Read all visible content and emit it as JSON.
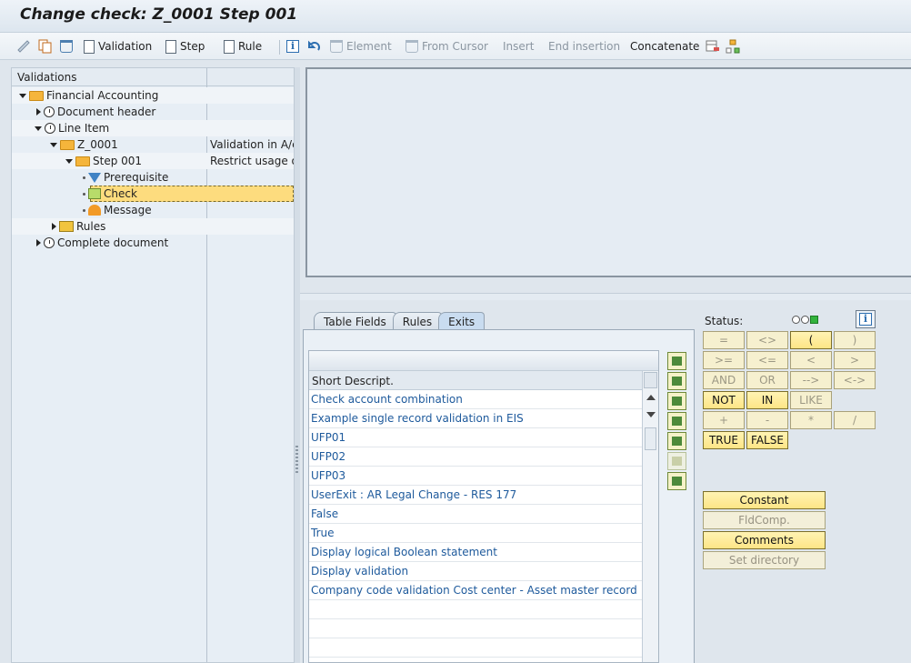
{
  "window": {
    "title": "Change check: Z_0001 Step 001"
  },
  "toolbar": {
    "validation": "Validation",
    "step": "Step",
    "rule": "Rule",
    "element": "Element",
    "from_cursor": "From Cursor",
    "insert": "Insert",
    "end_insertion": "End insertion",
    "concatenate": "Concatenate"
  },
  "tree": {
    "header": "Validations",
    "nodes": [
      {
        "label": "Financial Accounting",
        "desc": ""
      },
      {
        "label": "Document header",
        "desc": ""
      },
      {
        "label": "Line Item",
        "desc": ""
      },
      {
        "label": "Z_0001",
        "desc": "Validation in A/c"
      },
      {
        "label": "Step 001",
        "desc": "Restrict usage of"
      },
      {
        "label": "Prerequisite",
        "desc": ""
      },
      {
        "label": "Check",
        "desc": ""
      },
      {
        "label": "Message",
        "desc": ""
      },
      {
        "label": "Rules",
        "desc": ""
      },
      {
        "label": "Complete document",
        "desc": ""
      }
    ]
  },
  "tabs": [
    "Table Fields",
    "Rules",
    "Exits"
  ],
  "active_tab": "Exits",
  "exits_list": {
    "column_header": "Short Descript.",
    "rows": [
      "Check account combination",
      "Example single record validation in EIS",
      "UFP01",
      "UFP02",
      "UFP03",
      "UserExit : AR Legal Change - RES 177",
      "False",
      "True",
      "Display logical Boolean statement",
      "Display validation",
      "Company code validation  Cost center - Asset master record"
    ]
  },
  "status": {
    "label": "Status:"
  },
  "operators": [
    [
      "=",
      "<>",
      "(",
      ")"
    ],
    [
      ">=",
      "<=",
      "<",
      ">"
    ],
    [
      "AND",
      "OR",
      "-->",
      "<->"
    ],
    [
      "NOT",
      "IN",
      "LIKE"
    ],
    [
      "+",
      "-",
      "*",
      "/"
    ],
    [
      "TRUE",
      "FALSE"
    ]
  ],
  "action_buttons": {
    "constant": "Constant",
    "fldcomp": "FldComp.",
    "comments": "Comments",
    "set_directory": "Set directory"
  },
  "colors": {
    "selection": "#fddc7e",
    "link_text": "#1e5a9c",
    "button_yellow": "#fde586"
  }
}
